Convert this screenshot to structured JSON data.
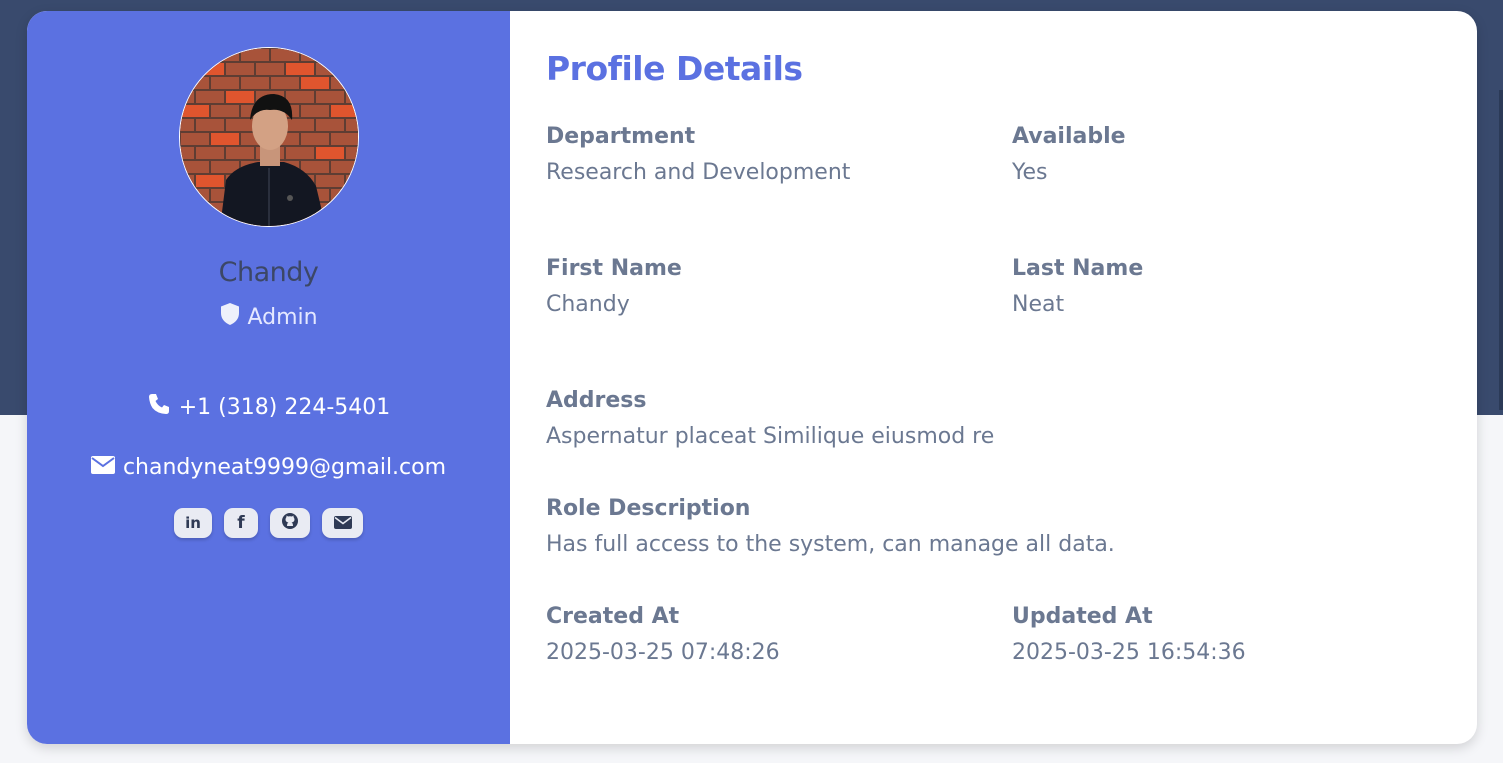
{
  "profile": {
    "name": "Chandy",
    "role": "Admin",
    "phone": "+1 (318) 224-5401",
    "email": "chandyneat9999@gmail.com",
    "socials": [
      {
        "label": "in",
        "name": "linkedin-icon"
      },
      {
        "label": "f",
        "name": "facebook-icon"
      },
      {
        "name": "github-icon"
      },
      {
        "name": "mail-icon"
      }
    ]
  },
  "details": {
    "title": "Profile Details",
    "department_label": "Department",
    "department_value": "Research and Development",
    "available_label": "Available",
    "available_value": "Yes",
    "first_name_label": "First Name",
    "first_name_value": "Chandy",
    "last_name_label": "Last Name",
    "last_name_value": "Neat",
    "address_label": "Address",
    "address_value": "Aspernatur placeat Similique eiusmod re",
    "role_desc_label": "Role Description",
    "role_desc_value": "Has full access to the system, can manage all data.",
    "created_label": "Created At",
    "created_value": "2025-03-25 07:48:26",
    "updated_label": "Updated At",
    "updated_value": "2025-03-25 16:54:36"
  },
  "colors": {
    "accent": "#5b71e1",
    "header_band": "#394a6d",
    "text_muted": "#687590"
  }
}
